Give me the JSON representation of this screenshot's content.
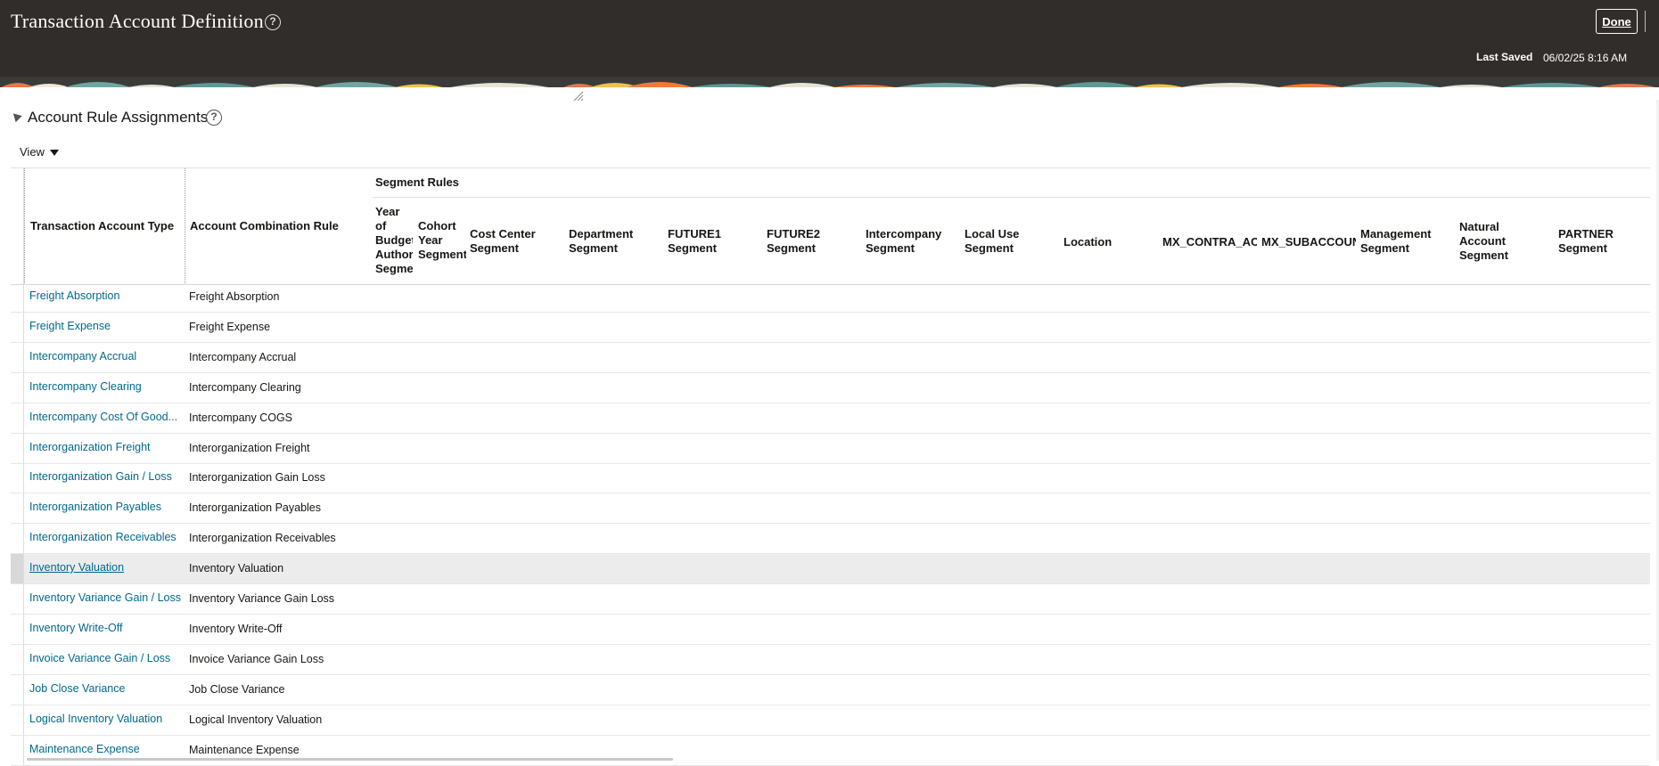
{
  "header": {
    "title": "Transaction Account Definition",
    "done_label": "Done",
    "last_saved_label": "Last Saved",
    "last_saved_value": "06/02/25 8:16 AM"
  },
  "section": {
    "title": "Account Rule Assignments",
    "view_menu_label": "View"
  },
  "table": {
    "columns": {
      "transaction_account_type": "Transaction Account Type",
      "account_combination_rule": "Account Combination Rule",
      "segment_rules_group": "Segment Rules",
      "segments": [
        "Year of Budget Authority Segment",
        "Cohort Year Segment",
        "Cost Center Segment",
        "Department Segment",
        "FUTURE1 Segment",
        "FUTURE2 Segment",
        "Intercompany Segment",
        "Local Use Segment",
        "Location",
        "MX_CONTRA_ACCOUNT",
        "MX_SUBACCOUNT",
        "Management Segment",
        "Natural Account Segment",
        "PARTNER Segment"
      ]
    },
    "rows": [
      {
        "type": "Freight Absorption",
        "rule": "Freight Absorption"
      },
      {
        "type": "Freight Expense",
        "rule": "Freight Expense"
      },
      {
        "type": "Intercompany Accrual",
        "rule": "Intercompany Accrual"
      },
      {
        "type": "Intercompany Clearing",
        "rule": "Intercompany Clearing"
      },
      {
        "type": "Intercompany Cost Of Good...",
        "rule": "Intercompany COGS"
      },
      {
        "type": "Interorganization Freight",
        "rule": "Interorganization Freight"
      },
      {
        "type": "Interorganization Gain / Loss",
        "rule": "Interorganization Gain Loss"
      },
      {
        "type": "Interorganization Payables",
        "rule": "Interorganization Payables"
      },
      {
        "type": "Interorganization Receivables",
        "rule": "Interorganization Receivables"
      },
      {
        "type": "Inventory Valuation",
        "rule": "Inventory Valuation",
        "selected": true
      },
      {
        "type": "Inventory Variance Gain / Loss",
        "rule": "Inventory Variance Gain Loss"
      },
      {
        "type": "Inventory Write-Off",
        "rule": "Inventory Write-Off"
      },
      {
        "type": "Invoice Variance Gain / Loss",
        "rule": "Invoice Variance Gain Loss"
      },
      {
        "type": "Job Close Variance",
        "rule": "Job Close Variance"
      },
      {
        "type": "Logical Inventory Valuation",
        "rule": "Logical Inventory Valuation"
      },
      {
        "type": "Maintenance Expense",
        "rule": "Maintenance Expense"
      }
    ]
  },
  "colors": {
    "header_bg": "#312d2a",
    "link": "#00688c",
    "selected_row": "#ececec"
  }
}
